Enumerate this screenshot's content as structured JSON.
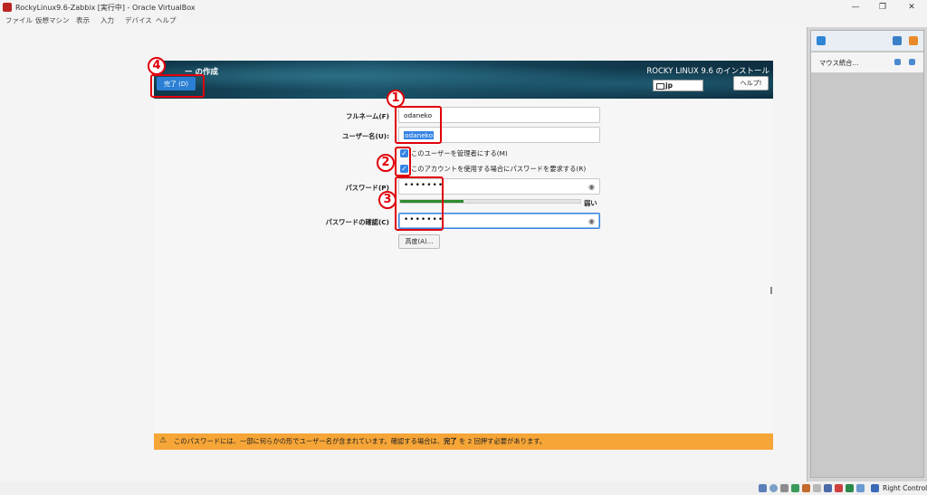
{
  "window": {
    "title": "RockyLinux9.6-Zabbix [実行中] - Oracle VirtualBox"
  },
  "menubar": {
    "items": [
      "ファイル",
      "仮想マシン",
      "表示",
      "入力",
      "デバイス",
      "ヘルプ"
    ]
  },
  "installer": {
    "page_title": "ー の作成",
    "os_title": "ROCKY LINUX 9.6 のインストール",
    "done_button": "完了 (D)",
    "keyboard_layout": "jp",
    "help_button": "ヘルプ!",
    "fullname_label": "フルネーム(F)",
    "fullname_value": "odaneko",
    "username_label": "ユーザー名(U):",
    "username_value": "odaneko",
    "admin_checkbox_label": "このユーザーを管理者にする(M)",
    "require_password_label": "このアカウントを使用する場合にパスワードを要求する(R)",
    "password_label": "パスワード(P)",
    "password_value": "•••••••",
    "strength_label": "弱い",
    "strength_fraction": 0.35,
    "confirm_label": "パスワードの確認(C)",
    "confirm_value": "•••••••",
    "advanced_button": "高度(A)...",
    "warning_text_before": "このパスワードには、一部に何らかの形でユーザー名が含まれています。確認する場合は、",
    "warning_bold": "完了",
    "warning_text_after": " を 2 回押す必要があります。"
  },
  "annotations": {
    "n1": "1",
    "n2": "2",
    "n3": "3",
    "n4": "4"
  },
  "sidepanel": {
    "mouse_integration": "マウス統合..."
  },
  "statusbar": {
    "host_key": "Right Control"
  },
  "colors": {
    "accent": "#3584e4",
    "annotation": "#e0000a",
    "warning": "#f6a537"
  }
}
